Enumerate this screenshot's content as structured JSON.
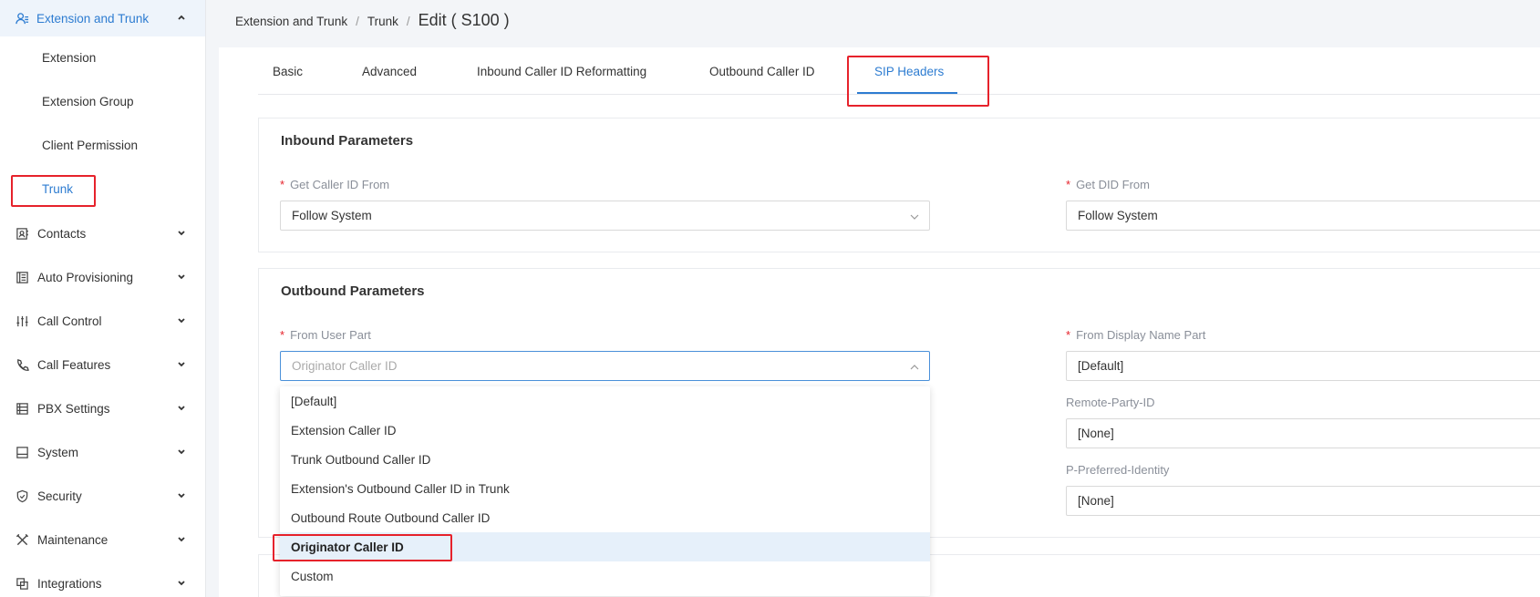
{
  "sidebar": {
    "group": "Extension and Trunk",
    "subitems": [
      "Extension",
      "Extension Group",
      "Client Permission",
      "Trunk"
    ],
    "items": [
      "Contacts",
      "Auto Provisioning",
      "Call Control",
      "Call Features",
      "PBX Settings",
      "System",
      "Security",
      "Maintenance",
      "Integrations"
    ]
  },
  "breadcrumb": {
    "level1": "Extension and Trunk",
    "level2": "Trunk",
    "sep": "/",
    "current": "Edit ( S100 )"
  },
  "tabs": [
    "Basic",
    "Advanced",
    "Inbound Caller ID Reformatting",
    "Outbound Caller ID",
    "SIP Headers"
  ],
  "inbound": {
    "title": "Inbound Parameters",
    "caller_id_label": "Get Caller ID From",
    "caller_id_value": "Follow System",
    "did_label": "Get DID From",
    "did_value": "Follow System"
  },
  "outbound": {
    "title": "Outbound Parameters",
    "from_user_label": "From User Part",
    "from_user_value": "Originator Caller ID",
    "from_display_label": "From Display Name Part",
    "from_display_value": "[Default]",
    "rpid_label": "Remote-Party-ID",
    "rpid_value": "[None]",
    "ppi_label": "P-Preferred-Identity",
    "ppi_value": "[None]"
  },
  "required_mark": "*",
  "dropdown_options": [
    "[Default]",
    "Extension Caller ID",
    "Trunk Outbound Caller ID",
    "Extension's Outbound Caller ID in Trunk",
    "Outbound Route Outbound Caller ID",
    "Originator Caller ID",
    "Custom"
  ],
  "colors": {
    "accent": "#2d7cd1",
    "highlight": "#e6222b"
  }
}
